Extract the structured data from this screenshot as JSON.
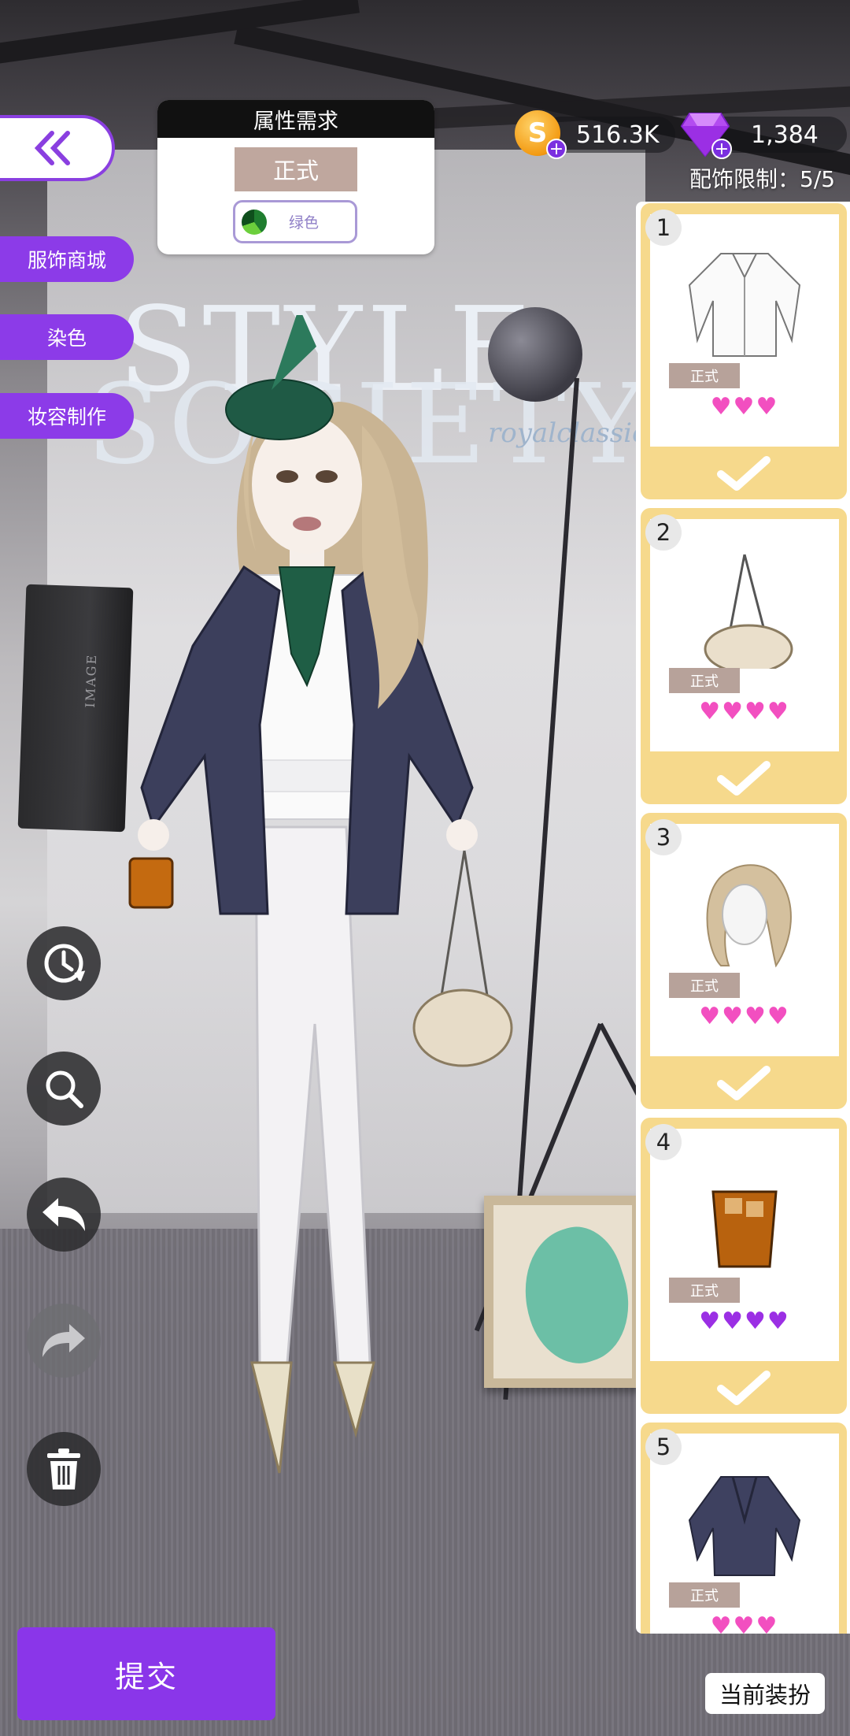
{
  "requirements": {
    "title": "属性需求",
    "style_tag": "正式",
    "color_label": "绿色"
  },
  "side_menu": [
    "服饰商城",
    "染色",
    "妆容制作"
  ],
  "currency": {
    "coins": "516.3K",
    "gems": "1,384"
  },
  "accessory_limit": "配饰限制：5/5",
  "backdrop": {
    "logo_line1": "STYLE",
    "logo_line2": "SOCIETY",
    "logo_script": "royalclassic",
    "softbox_text": "IMAGE"
  },
  "items": [
    {
      "num": "1",
      "tag": "正式",
      "hearts": "♥♥♥",
      "heart_color": "#f24fc0",
      "icon": "white-shirt-icon",
      "equipped": true
    },
    {
      "num": "2",
      "tag": "正式",
      "hearts": "♥♥♥♥",
      "heart_color": "#f24fc0",
      "icon": "shell-bag-icon",
      "equipped": true
    },
    {
      "num": "3",
      "tag": "正式",
      "hearts": "♥♥♥♥",
      "heart_color": "#f24fc0",
      "icon": "wavy-hair-icon",
      "equipped": true
    },
    {
      "num": "4",
      "tag": "正式",
      "hearts": "♥♥♥♥",
      "heart_color": "#9b2fe4",
      "icon": "whiskey-glass-icon",
      "equipped": true
    },
    {
      "num": "5",
      "tag": "正式",
      "hearts": "♥♥♥",
      "heart_color": "#f24fc0",
      "icon": "navy-blazer-icon",
      "equipped": false
    }
  ],
  "buttons": {
    "submit": "提交",
    "current_outfit": "当前装扮"
  },
  "colors": {
    "accent_purple": "#8a36e9",
    "card_gold": "#f6d98c",
    "tag_brown": "#bfa79e"
  }
}
